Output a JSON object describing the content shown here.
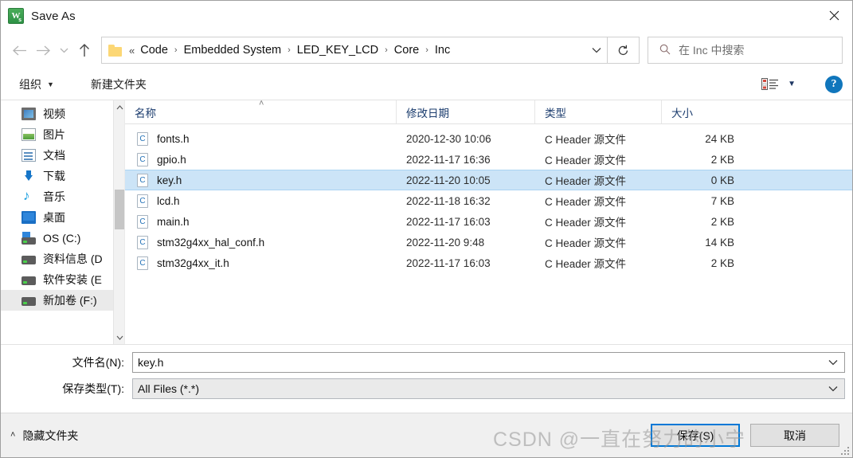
{
  "window": {
    "title": "Save As",
    "app_icon": "wps-writer-icon",
    "close_label": "✕"
  },
  "nav": {
    "back_icon": "arrow-left-icon",
    "forward_icon": "arrow-right-icon",
    "recent_icon": "chevron-down-icon",
    "up_icon": "arrow-up-icon",
    "refresh_icon": "refresh-icon",
    "breadcrumb_lead": "«",
    "breadcrumb": [
      "Code",
      "Embedded System",
      "LED_KEY_LCD",
      "Core",
      "Inc"
    ],
    "breadcrumb_separator": "›",
    "dropdown_icon": "chevron-down-icon"
  },
  "search": {
    "icon": "search-icon",
    "placeholder": "在 Inc 中搜索"
  },
  "toolbar": {
    "organize_label": "组织",
    "organize_caret": "▼",
    "new_folder_label": "新建文件夹",
    "view_icon": "list-view-icon",
    "view_caret": "▼",
    "help_label": "?"
  },
  "sidebar": {
    "items": [
      {
        "label": "视频",
        "icon": "video-folder-icon"
      },
      {
        "label": "图片",
        "icon": "pictures-folder-icon"
      },
      {
        "label": "文档",
        "icon": "documents-folder-icon"
      },
      {
        "label": "下载",
        "icon": "downloads-folder-icon"
      },
      {
        "label": "音乐",
        "icon": "music-folder-icon"
      },
      {
        "label": "桌面",
        "icon": "desktop-folder-icon"
      },
      {
        "label": "OS (C:)",
        "icon": "system-drive-icon"
      },
      {
        "label": "资料信息 (D",
        "icon": "drive-icon"
      },
      {
        "label": "软件安装 (E",
        "icon": "drive-icon"
      },
      {
        "label": "新加卷 (F:)",
        "icon": "drive-icon"
      }
    ],
    "selected_index": 9,
    "scroll_up_icon": "chevron-up-icon",
    "scroll_down_icon": "chevron-down-icon"
  },
  "filelist": {
    "columns": [
      {
        "key": "name",
        "label": "名称"
      },
      {
        "key": "date",
        "label": "修改日期"
      },
      {
        "key": "type",
        "label": "类型"
      },
      {
        "key": "size",
        "label": "大小"
      }
    ],
    "sort_caret": "˄",
    "selected_index": 2,
    "rows": [
      {
        "icon": "c-header-file-icon",
        "name": "fonts.h",
        "date": "2020-12-30 10:06",
        "type": "C Header 源文件",
        "size": "24 KB"
      },
      {
        "icon": "c-header-file-icon",
        "name": "gpio.h",
        "date": "2022-11-17 16:36",
        "type": "C Header 源文件",
        "size": "2 KB"
      },
      {
        "icon": "c-header-file-icon",
        "name": "key.h",
        "date": "2022-11-20 10:05",
        "type": "C Header 源文件",
        "size": "0 KB"
      },
      {
        "icon": "c-header-file-icon",
        "name": "lcd.h",
        "date": "2022-11-18 16:32",
        "type": "C Header 源文件",
        "size": "7 KB"
      },
      {
        "icon": "c-header-file-icon",
        "name": "main.h",
        "date": "2022-11-17 16:03",
        "type": "C Header 源文件",
        "size": "2 KB"
      },
      {
        "icon": "c-header-file-icon",
        "name": "stm32g4xx_hal_conf.h",
        "date": "2022-11-20 9:48",
        "type": "C Header 源文件",
        "size": "14 KB"
      },
      {
        "icon": "c-header-file-icon",
        "name": "stm32g4xx_it.h",
        "date": "2022-11-17 16:03",
        "type": "C Header 源文件",
        "size": "2 KB"
      }
    ]
  },
  "form": {
    "filename_label": "文件名(N):",
    "filename_value": "key.h",
    "filetype_label": "保存类型(T):",
    "filetype_value": "All Files (*.*)",
    "dropdown_icon": "chevron-down-icon"
  },
  "footer": {
    "hide_folders_caret": "˄",
    "hide_folders_label": "隐藏文件夹",
    "save_label": "保存(S)",
    "cancel_label": "取消"
  },
  "watermark": {
    "text": "CSDN @一直在努力的小宁"
  },
  "colors": {
    "accent": "#0078d7",
    "selection": "#cce4f7",
    "header_text": "#1b3c6e",
    "help_blue": "#1076bc"
  }
}
